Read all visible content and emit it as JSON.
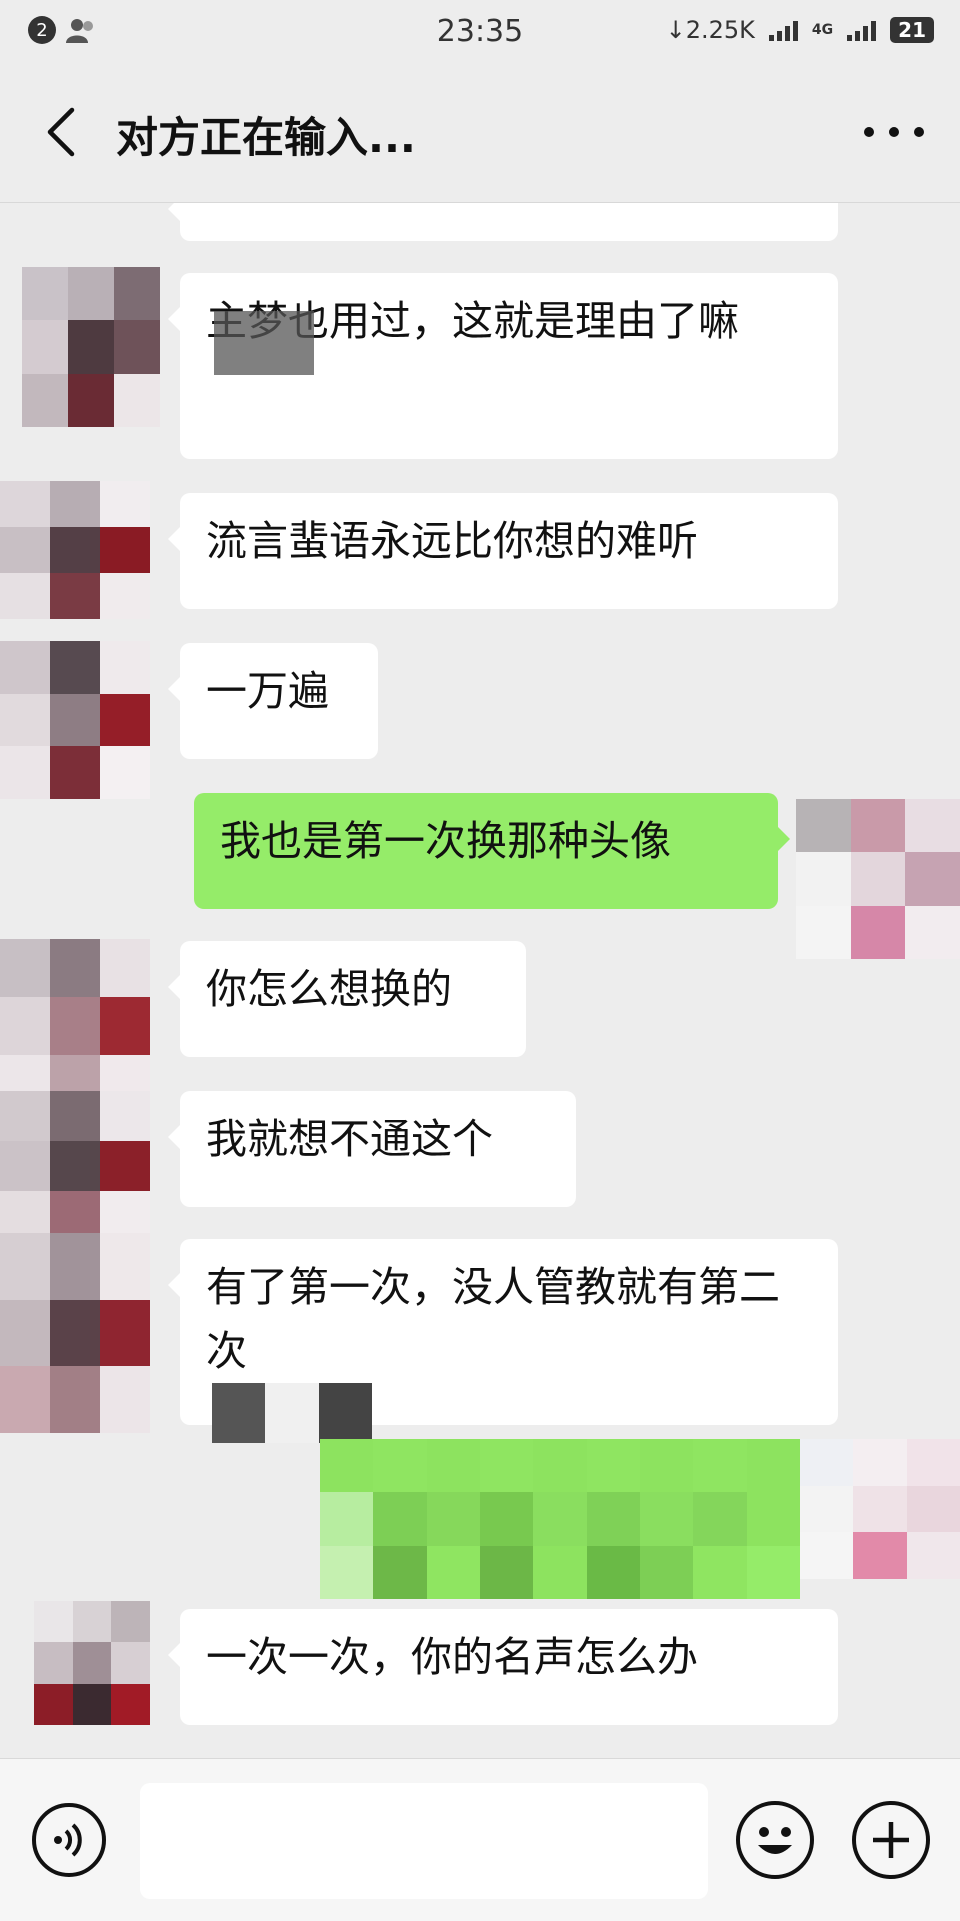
{
  "status_bar": {
    "notification_count": "2",
    "time": "23:35",
    "network_speed": "↓2.25K",
    "network_type": "4G",
    "battery": "21"
  },
  "header": {
    "title": "对方正在输入..."
  },
  "messages": [
    {
      "side": "in",
      "text": ""
    },
    {
      "side": "in",
      "text": "主梦也用过，这就是理由了嘛"
    },
    {
      "side": "in",
      "text": "流言蜚语永远比你想的难听"
    },
    {
      "side": "in",
      "text": "一万遍"
    },
    {
      "side": "out",
      "text": "我也是第一次换那种头像"
    },
    {
      "side": "in",
      "text": "你怎么想换的"
    },
    {
      "side": "in",
      "text": "我就想不通这个"
    },
    {
      "side": "in",
      "text": "有了第一次，没人管教就有第二次"
    },
    {
      "side": "out",
      "text": ""
    },
    {
      "side": "in",
      "text": "一次一次，你的名声怎么办"
    }
  ],
  "input_bar": {
    "voice_icon": "voice-icon",
    "emoji_icon": "emoji-icon",
    "plus_icon": "plus-icon"
  },
  "colors": {
    "background": "#ededed",
    "incoming_bubble": "#ffffff",
    "outgoing_bubble": "#95ec69"
  }
}
